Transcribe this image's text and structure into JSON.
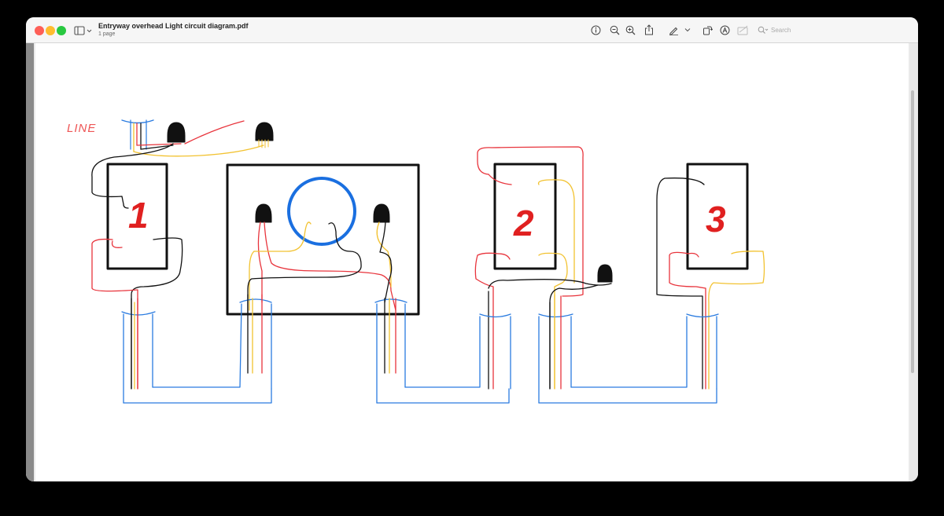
{
  "window": {
    "title": "Entryway overhead Light circuit diagram.pdf",
    "subtitle": "1 page"
  },
  "toolbar": {
    "search_placeholder": "Search",
    "icons": [
      "sidebar-icon",
      "info-icon",
      "zoom-out-icon",
      "zoom-in-icon",
      "share-icon",
      "markup-pen-icon",
      "rotate-icon",
      "annotate-icon",
      "redact-icon",
      "search-icon"
    ]
  },
  "diagram": {
    "line_label": "LINE",
    "switch_labels": [
      "1",
      "2",
      "3"
    ],
    "wire_colors": {
      "hot": "#e8343c",
      "neutral_black": "#111111",
      "traveler_yellow": "#f2c230",
      "conduit_blue": "#2a7be0",
      "light_fixture": "#1a6fe0",
      "label_red": "#e02020"
    }
  }
}
